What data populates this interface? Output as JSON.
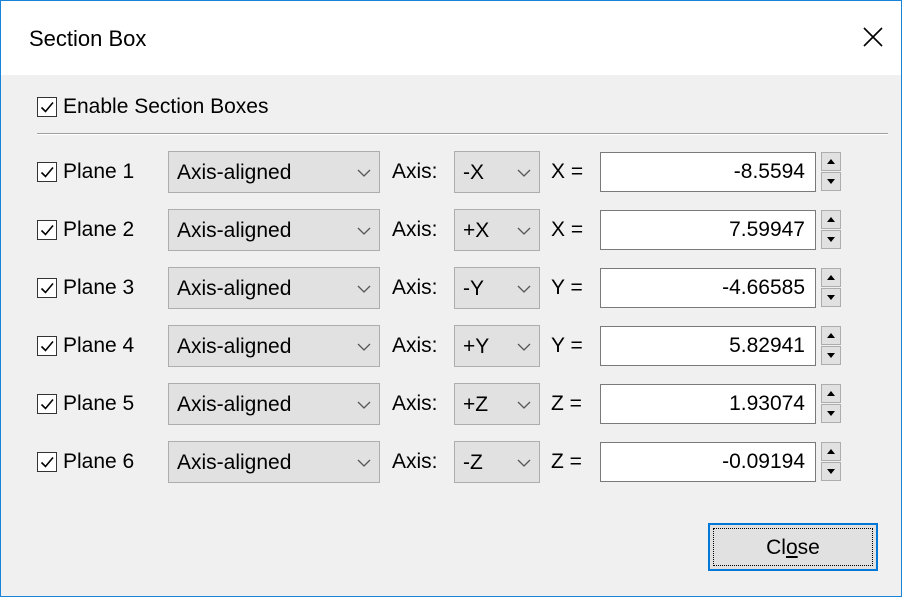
{
  "window": {
    "title": "Section Box",
    "close_icon": "close-icon"
  },
  "enable": {
    "label": "Enable Section Boxes",
    "checked": true
  },
  "planes": [
    {
      "label": "Plane 1",
      "checked": true,
      "mode": "Axis-aligned",
      "axis_label": "Axis:",
      "axis": "-X",
      "coord_label": "X =",
      "value": "-8.5594"
    },
    {
      "label": "Plane 2",
      "checked": true,
      "mode": "Axis-aligned",
      "axis_label": "Axis:",
      "axis": "+X",
      "coord_label": "X =",
      "value": "7.59947"
    },
    {
      "label": "Plane 3",
      "checked": true,
      "mode": "Axis-aligned",
      "axis_label": "Axis:",
      "axis": "-Y",
      "coord_label": "Y =",
      "value": "-4.66585"
    },
    {
      "label": "Plane 4",
      "checked": true,
      "mode": "Axis-aligned",
      "axis_label": "Axis:",
      "axis": "+Y",
      "coord_label": "Y =",
      "value": "5.82941"
    },
    {
      "label": "Plane 5",
      "checked": true,
      "mode": "Axis-aligned",
      "axis_label": "Axis:",
      "axis": "+Z",
      "coord_label": "Z =",
      "value": "1.93074"
    },
    {
      "label": "Plane 6",
      "checked": true,
      "mode": "Axis-aligned",
      "axis_label": "Axis:",
      "axis": "-Z",
      "coord_label": "Z =",
      "value": "-0.09194"
    }
  ],
  "footer": {
    "close_label_pre": "Cl",
    "close_label_mnemonic": "o",
    "close_label_post": "se"
  },
  "colors": {
    "accent": "#0078d7",
    "window_border": "#1883d7"
  }
}
